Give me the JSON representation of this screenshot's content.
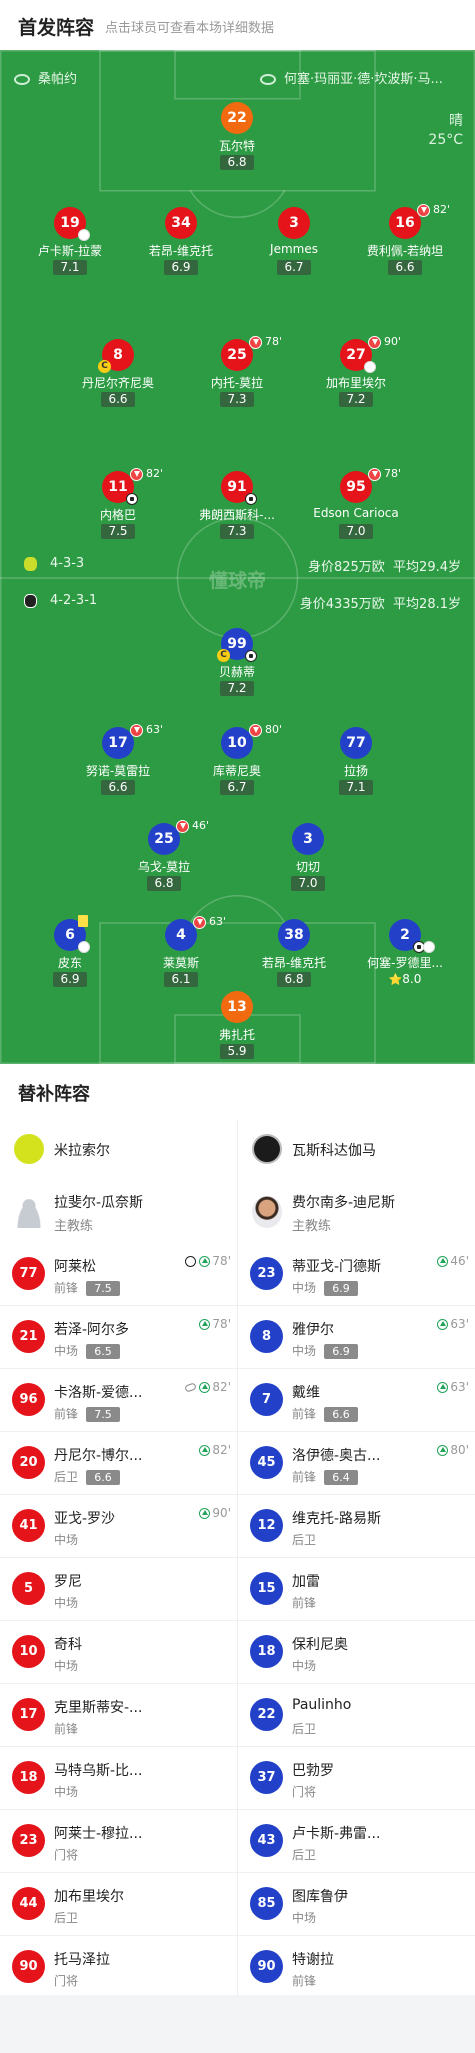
{
  "header": {
    "title": "首发阵容",
    "subtitle": "点击球员可查看本场详细数据"
  },
  "pitch": {
    "home_team": "桑帕约",
    "away_team": "何塞·玛丽亚·德·坎波斯·马...",
    "weather": "晴",
    "temperature": "25°C",
    "watermark": "懂球帝",
    "home_formation": "4-3-3",
    "home_value": "身价825万欧",
    "home_age": "平均29.4岁",
    "away_formation": "4-2-3-1",
    "away_value": "身价4335万欧",
    "away_age": "平均28.1岁"
  },
  "home_players": [
    {
      "num": "22",
      "name": "瓦尔特",
      "rating": "6.8",
      "gk": true
    },
    {
      "num": "19",
      "name": "卢卡斯-拉蒙",
      "rating": "7.1"
    },
    {
      "num": "34",
      "name": "若昂-维克托",
      "rating": "6.9"
    },
    {
      "num": "3",
      "name": "Jemmes",
      "rating": "6.7"
    },
    {
      "num": "16",
      "name": "费利佩-若纳坦",
      "rating": "6.6",
      "sub": "82'"
    },
    {
      "num": "8",
      "name": "丹尼尔齐尼奥",
      "rating": "6.6"
    },
    {
      "num": "25",
      "name": "内托-莫拉",
      "rating": "7.3",
      "sub": "78'"
    },
    {
      "num": "27",
      "name": "加布里埃尔",
      "rating": "7.2",
      "sub": "90'"
    },
    {
      "num": "11",
      "name": "内格巴",
      "rating": "7.5",
      "sub": "82'"
    },
    {
      "num": "91",
      "name": "弗朗西斯科-...",
      "rating": "7.3"
    },
    {
      "num": "95",
      "name": "Edson Carioca",
      "rating": "7.0",
      "sub": "78'"
    }
  ],
  "away_players": [
    {
      "num": "99",
      "name": "贝赫蒂",
      "rating": "7.2"
    },
    {
      "num": "17",
      "name": "努诺-莫雷拉",
      "rating": "6.6",
      "sub": "63'"
    },
    {
      "num": "10",
      "name": "库蒂尼奥",
      "rating": "6.7",
      "sub": "80'"
    },
    {
      "num": "77",
      "name": "拉扬",
      "rating": "7.1"
    },
    {
      "num": "25",
      "name": "乌戈-莫拉",
      "rating": "6.8",
      "sub": "46'"
    },
    {
      "num": "3",
      "name": "切切",
      "rating": "7.0"
    },
    {
      "num": "6",
      "name": "皮东",
      "rating": "6.9"
    },
    {
      "num": "4",
      "name": "莱莫斯",
      "rating": "6.1",
      "sub": "63'"
    },
    {
      "num": "38",
      "name": "若昂-维克托",
      "rating": "6.8"
    },
    {
      "num": "2",
      "name": "何塞-罗德里...",
      "rating": "8.0",
      "motm": true
    },
    {
      "num": "13",
      "name": "弗扎托",
      "rating": "5.9",
      "gk": true
    }
  ],
  "bench_title": "替补阵容",
  "home_bench": {
    "team": "米拉索尔",
    "coach": "拉斐尔-瓜奈斯",
    "coach_role": "主教练",
    "players": [
      {
        "num": "77",
        "name": "阿莱松",
        "pos": "前锋",
        "rating": "7.5",
        "ev": "78'",
        "goal": true
      },
      {
        "num": "21",
        "name": "若泽-阿尔多",
        "pos": "中场",
        "rating": "6.5",
        "ev": "78'"
      },
      {
        "num": "96",
        "name": "卡洛斯-爱德...",
        "pos": "前锋",
        "rating": "7.5",
        "ev": "82'",
        "assist": true
      },
      {
        "num": "20",
        "name": "丹尼尔-博尔...",
        "pos": "后卫",
        "rating": "6.6",
        "ev": "82'"
      },
      {
        "num": "41",
        "name": "亚戈-罗沙",
        "pos": "中场",
        "ev": "90'"
      },
      {
        "num": "5",
        "name": "罗尼",
        "pos": "中场"
      },
      {
        "num": "10",
        "name": "奇科",
        "pos": "中场"
      },
      {
        "num": "17",
        "name": "克里斯蒂安-...",
        "pos": "前锋"
      },
      {
        "num": "18",
        "name": "马特乌斯-比...",
        "pos": "中场"
      },
      {
        "num": "23",
        "name": "阿莱士-穆拉...",
        "pos": "门将"
      },
      {
        "num": "44",
        "name": "加布里埃尔",
        "pos": "后卫"
      },
      {
        "num": "90",
        "name": "托马泽拉",
        "pos": "门将"
      }
    ]
  },
  "away_bench": {
    "team": "瓦斯科达伽马",
    "coach": "费尔南多-迪尼斯",
    "coach_role": "主教练",
    "players": [
      {
        "num": "23",
        "name": "蒂亚戈-门德斯",
        "pos": "中场",
        "rating": "6.9",
        "ev": "46'"
      },
      {
        "num": "8",
        "name": "雅伊尔",
        "pos": "中场",
        "rating": "6.9",
        "ev": "63'"
      },
      {
        "num": "7",
        "name": "戴维",
        "pos": "前锋",
        "rating": "6.6",
        "ev": "63'"
      },
      {
        "num": "45",
        "name": "洛伊德-奥古...",
        "pos": "前锋",
        "rating": "6.4",
        "ev": "80'"
      },
      {
        "num": "12",
        "name": "维克托-路易斯",
        "pos": "后卫"
      },
      {
        "num": "15",
        "name": "加雷",
        "pos": "前锋"
      },
      {
        "num": "18",
        "name": "保利尼奥",
        "pos": "中场"
      },
      {
        "num": "22",
        "name": "Paulinho",
        "pos": "后卫"
      },
      {
        "num": "37",
        "name": "巴勃罗",
        "pos": "门将"
      },
      {
        "num": "43",
        "name": "卢卡斯-弗雷...",
        "pos": "后卫"
      },
      {
        "num": "85",
        "name": "图库鲁伊",
        "pos": "中场"
      },
      {
        "num": "90",
        "name": "特谢拉",
        "pos": "前锋"
      }
    ]
  },
  "colors": {
    "pitch": "#2d9b43",
    "home": "#e4141a",
    "away": "#2341c8",
    "gk": "#f26a10"
  }
}
